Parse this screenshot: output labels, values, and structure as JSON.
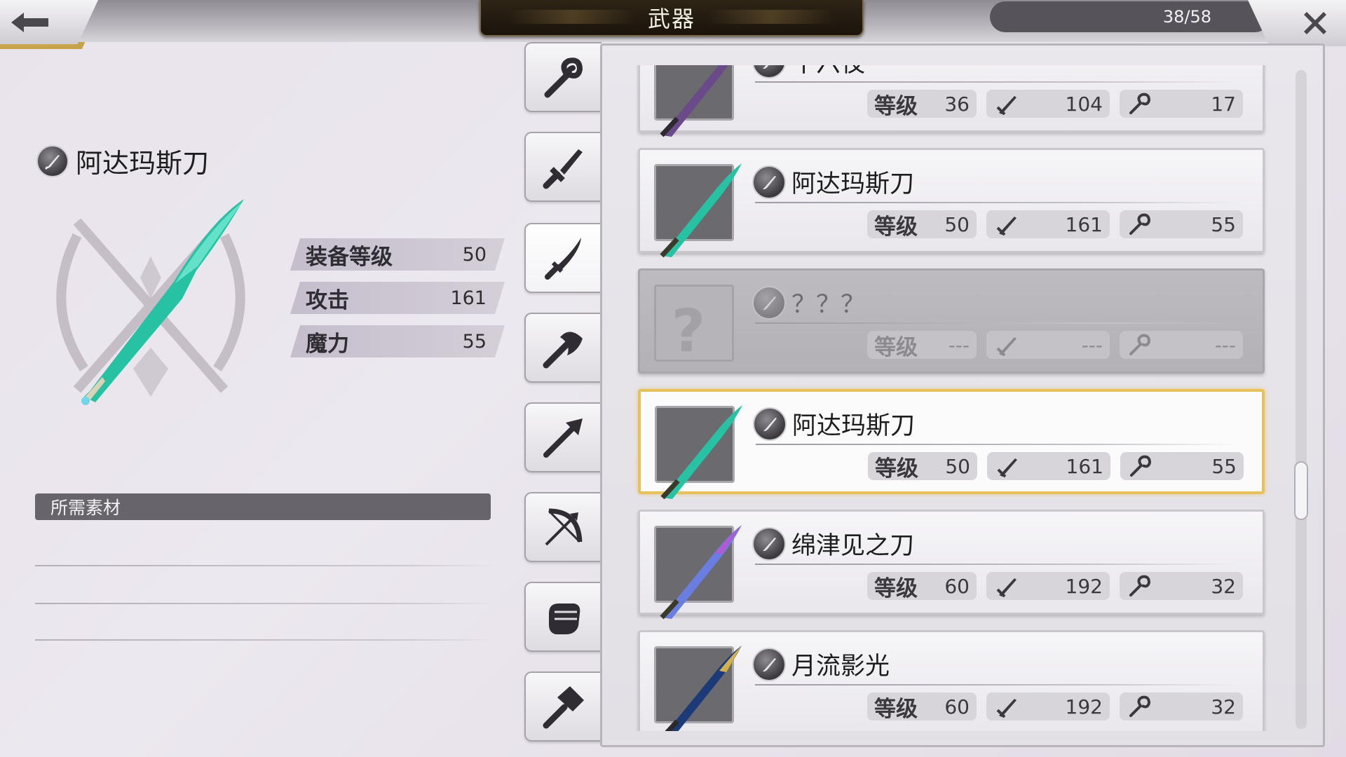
{
  "header": {
    "title": "武器",
    "counter": "38/58"
  },
  "detail": {
    "name": "阿达玛斯刀",
    "stats": [
      {
        "label": "装备等级",
        "value": "50"
      },
      {
        "label": "攻击",
        "value": "161"
      },
      {
        "label": "魔力",
        "value": "55"
      }
    ],
    "materials_label": "所需素材"
  },
  "tabs": [
    {
      "icon": "staff-icon",
      "active": false
    },
    {
      "icon": "sword-icon",
      "active": false
    },
    {
      "icon": "katana-icon",
      "active": true
    },
    {
      "icon": "axe-icon",
      "active": false
    },
    {
      "icon": "spear-icon",
      "active": false
    },
    {
      "icon": "bow-icon",
      "active": false
    },
    {
      "icon": "fist-icon",
      "active": false
    },
    {
      "icon": "hammer-icon",
      "active": false
    }
  ],
  "list": {
    "level_label": "等级",
    "items": [
      {
        "name": "十六夜",
        "level": "36",
        "attack": "104",
        "magic": "17",
        "state": "normal",
        "blade": "#6b4a8a"
      },
      {
        "name": "阿达玛斯刀",
        "level": "50",
        "attack": "161",
        "magic": "55",
        "state": "normal",
        "blade": "#27c2a4"
      },
      {
        "name": "？？？",
        "level": "---",
        "attack": "---",
        "magic": "---",
        "state": "locked",
        "blade": "#b0aeb3"
      },
      {
        "name": "阿达玛斯刀",
        "level": "50",
        "attack": "161",
        "magic": "55",
        "state": "selected",
        "blade": "#27c2a4"
      },
      {
        "name": "绵津见之刀",
        "level": "60",
        "attack": "192",
        "magic": "32",
        "state": "normal",
        "blade": "#6a7de0"
      },
      {
        "name": "月流影光",
        "level": "60",
        "attack": "192",
        "magic": "32",
        "state": "normal",
        "blade": "#1d3a78"
      }
    ]
  },
  "colors": {
    "accent_gold": "#e7c25c",
    "title_plate": "#1a140c"
  }
}
